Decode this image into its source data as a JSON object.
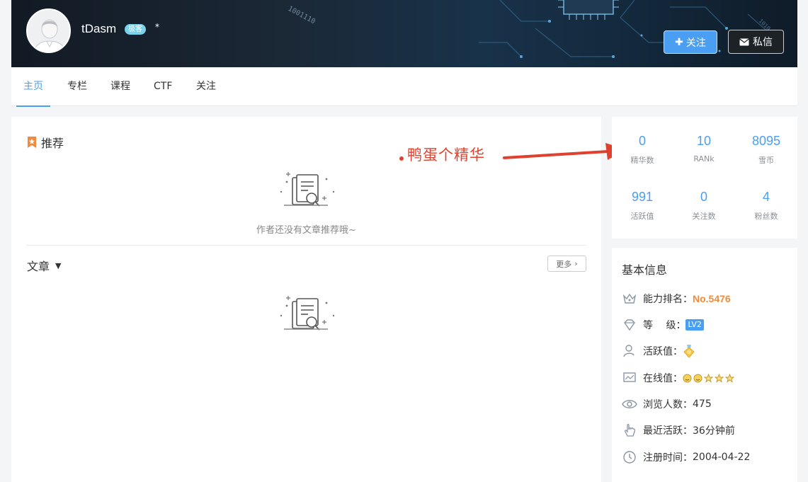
{
  "header": {
    "username": "tDasm",
    "badge": "极客",
    "star_glyph": "*",
    "follow_label": "关注",
    "message_label": "私信",
    "banner_binary_text": "1001110"
  },
  "tabs": [
    {
      "label": "主页",
      "active": true
    },
    {
      "label": "专栏",
      "active": false
    },
    {
      "label": "课程",
      "active": false
    },
    {
      "label": "CTF",
      "active": false
    },
    {
      "label": "关注",
      "active": false
    }
  ],
  "recommend": {
    "title": "推荐",
    "empty_text": "作者还没有文章推荐哦~"
  },
  "articles": {
    "title": "文章",
    "more_label": "更多"
  },
  "annotation": {
    "text": "鸭蛋个精华"
  },
  "stats": [
    {
      "value": "0",
      "label": "精华数"
    },
    {
      "value": "10",
      "label": "RANk"
    },
    {
      "value": "8095",
      "label": "雪币"
    },
    {
      "value": "991",
      "label": "活跃值"
    },
    {
      "value": "0",
      "label": "关注数"
    },
    {
      "value": "4",
      "label": "粉丝数"
    }
  ],
  "basic_info": {
    "title": "基本信息",
    "rows": [
      {
        "label": "能力排名：",
        "value": "No.5476",
        "icon": "crown-icon"
      },
      {
        "label": "等　 级：",
        "value": "LV2",
        "icon": "diamond-icon"
      },
      {
        "label": "活跃值：",
        "value": "",
        "icon": "user-activity-icon"
      },
      {
        "label": "在线值：",
        "value": "",
        "icon": "monitor-icon"
      },
      {
        "label": "浏览人数：",
        "value": "475",
        "icon": "eye-icon"
      },
      {
        "label": "最近活跃：",
        "value": "36分钟前",
        "icon": "hand-pointer-icon"
      },
      {
        "label": "注册时间：",
        "value": "2004-04-22",
        "icon": "clock-icon"
      }
    ]
  },
  "colors": {
    "accent": "#4a9ff2",
    "rank": "#f08b3e",
    "annotation": "#e0412e"
  }
}
